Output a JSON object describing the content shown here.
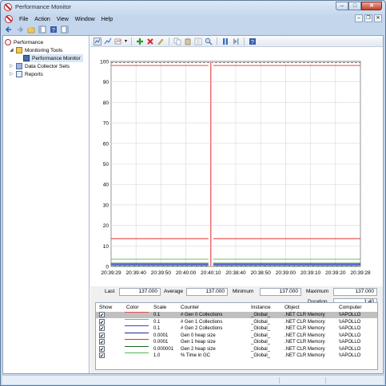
{
  "window": {
    "title": "Performance Monitor"
  },
  "menu": {
    "items": [
      "File",
      "Action",
      "View",
      "Window",
      "Help"
    ]
  },
  "tree": {
    "root": "Performance",
    "monitoring_tools": "Monitoring Tools",
    "performance_monitor": "Performance Monitor",
    "data_collector_sets": "Data Collector Sets",
    "reports": "Reports"
  },
  "chart_data": {
    "type": "line",
    "ylim": [
      0,
      100
    ],
    "y_ticks": [
      "100",
      "90",
      "80",
      "70",
      "60",
      "50",
      "40",
      "30",
      "20",
      "10",
      "0"
    ],
    "x_ticks": [
      "20:39:29",
      "20:39:40",
      "20:39:50",
      "20:40:00",
      "20:40:10",
      "20:38:40",
      "20:38:50",
      "20:39:00",
      "20:39:10",
      "20:39:20",
      "20:39:28"
    ],
    "current_time_marker": "20:40:10",
    "series": [
      {
        "name": "# Gen 0 Collections",
        "color": "#e84a4a",
        "values": [
          98,
          98,
          98,
          98,
          98,
          98,
          98,
          98,
          98,
          98,
          98
        ]
      },
      {
        "name": "# Gen 1 Collections",
        "color": "#6abf6a",
        "values": [
          3.5,
          3.5,
          3.5,
          3.5,
          3.5,
          3.5,
          3.5,
          3.5,
          3.5,
          3.5,
          3.5
        ]
      },
      {
        "name": "# Gen 2 Collections",
        "color": "#3c3cd8",
        "values": [
          1,
          1,
          1,
          1,
          1,
          1,
          1,
          1,
          1,
          1,
          1
        ]
      },
      {
        "name": "Gen 0 heap size",
        "color": "#1f2a8a",
        "values": [
          0.4,
          0.4,
          0.4,
          0.4,
          0.4,
          0.4,
          0.4,
          0.4,
          0.4,
          0.4,
          0.4
        ]
      },
      {
        "name": "Gen 1 heap size",
        "color": "#e03030",
        "values": [
          13.5,
          13.5,
          13.5,
          13.5,
          13.5,
          13.5,
          13.5,
          13.5,
          13.5,
          13.5,
          13.5
        ]
      },
      {
        "name": "Gen 2 heap size",
        "color": "#1a6a1a",
        "values": [
          1.5,
          1.5,
          1.5,
          1.5,
          1.5,
          1.5,
          1.5,
          1.5,
          1.5,
          1.5,
          1.5
        ]
      },
      {
        "name": "% Time in GC",
        "color": "#50b850",
        "values": [
          0.2,
          0.2,
          0.2,
          0.2,
          0.2,
          0.2,
          0.2,
          0.2,
          0.2,
          0.2,
          0.2
        ]
      }
    ]
  },
  "stats": {
    "last_label": "Last",
    "last_value": "137.000",
    "average_label": "Average",
    "average_value": "137.000",
    "minimum_label": "Minimum",
    "minimum_value": "137.000",
    "maximum_label": "Maximum",
    "maximum_value": "137.000",
    "duration_label": "Duration",
    "duration_value": "1:40"
  },
  "legend": {
    "headers": {
      "show": "Show",
      "color": "Color",
      "scale": "Scale",
      "counter": "Counter",
      "instance": "Instance",
      "object": "Object",
      "computer": "Computer"
    },
    "rows": [
      {
        "color": "#e84a4a",
        "scale": "0.1",
        "counter": "# Gen 0 Collections",
        "instance": "_Global_",
        "object": ".NET CLR Memory",
        "computer": "\\\\APOLLO"
      },
      {
        "color": "#6abf6a",
        "scale": "0.1",
        "counter": "# Gen 1 Collections",
        "instance": "_Global_",
        "object": ".NET CLR Memory",
        "computer": "\\\\APOLLO"
      },
      {
        "color": "#3c3cd8",
        "scale": "0.1",
        "counter": "# Gen 2 Collections",
        "instance": "_Global_",
        "object": ".NET CLR Memory",
        "computer": "\\\\APOLLO"
      },
      {
        "color": "#1f2a8a",
        "scale": "0.0001",
        "counter": "Gen 0 heap size",
        "instance": "_Global_",
        "object": ".NET CLR Memory",
        "computer": "\\\\APOLLO"
      },
      {
        "color": "#e03030",
        "scale": "0.0001",
        "counter": "Gen 1 heap size",
        "instance": "_Global_",
        "object": ".NET CLR Memory",
        "computer": "\\\\APOLLO"
      },
      {
        "color": "#1a6a1a",
        "scale": "0.000001",
        "counter": "Gen 2 heap size",
        "instance": "_Global_",
        "object": ".NET CLR Memory",
        "computer": "\\\\APOLLO"
      },
      {
        "color": "#50b850",
        "scale": "1.0",
        "counter": "% Time in GC",
        "instance": "_Global_",
        "object": ".NET CLR Memory",
        "computer": "\\\\APOLLO"
      }
    ]
  }
}
